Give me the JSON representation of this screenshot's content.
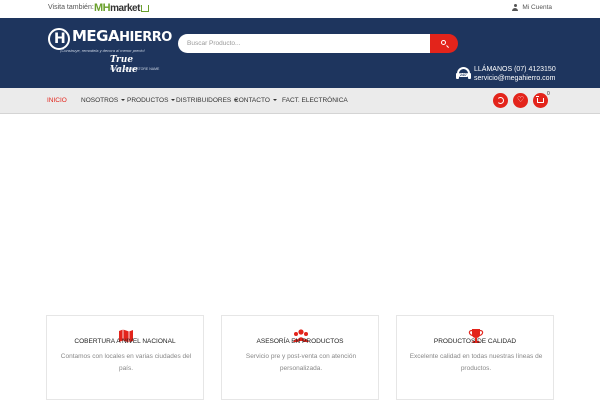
{
  "topbar": {
    "visit_label": "Visita también:",
    "mh_logo_mh": "MH",
    "mh_logo_market": "market",
    "account_label": "Mi Cuenta"
  },
  "header": {
    "brand_mega": "MEGA",
    "brand_hierro": "HIERRO",
    "slogan": "¡Construye, remodela y decora al menor precio!",
    "partner": "True Value",
    "partner_sub": "STORE NAME • STORE NAME",
    "search_placeholder": "Buscar Producto...",
    "phone_tag": "24/7",
    "phone_label": "LLÁMANOS (07) 4123150",
    "email": "servicio@megahierro.com"
  },
  "nav": {
    "items": [
      {
        "label": "INICIO",
        "active": true,
        "dropdown": false
      },
      {
        "label": "NOSOTROS",
        "active": false,
        "dropdown": true
      },
      {
        "label": "PRODUCTOS",
        "active": false,
        "dropdown": true
      },
      {
        "label": "DISTRIBUIDORES",
        "active": false,
        "dropdown": true
      },
      {
        "label": "CONTACTO",
        "active": false,
        "dropdown": true
      },
      {
        "label": "FACT. ELECTRÓNICA",
        "active": false,
        "dropdown": false
      }
    ],
    "cart_count": "0"
  },
  "features": [
    {
      "icon": "map-icon",
      "title": "COBERTURA A NIVEL NACIONAL",
      "desc": "Contamos con locales en varias ciudades del país."
    },
    {
      "icon": "users-icon",
      "title": "ASESORÍA EN PRODUCTOS",
      "desc": "Servicio pre y post-venta con atención personalizada."
    },
    {
      "icon": "trophy-icon",
      "title": "PRODUCTOS DE CALIDAD",
      "desc": "Excelente calidad en todas nuestras líneas de productos."
    }
  ],
  "colors": {
    "header_bg": "#1e355e",
    "accent": "#e3241b",
    "nav_bg": "#ebebeb",
    "mh_green": "#6aa02c"
  }
}
